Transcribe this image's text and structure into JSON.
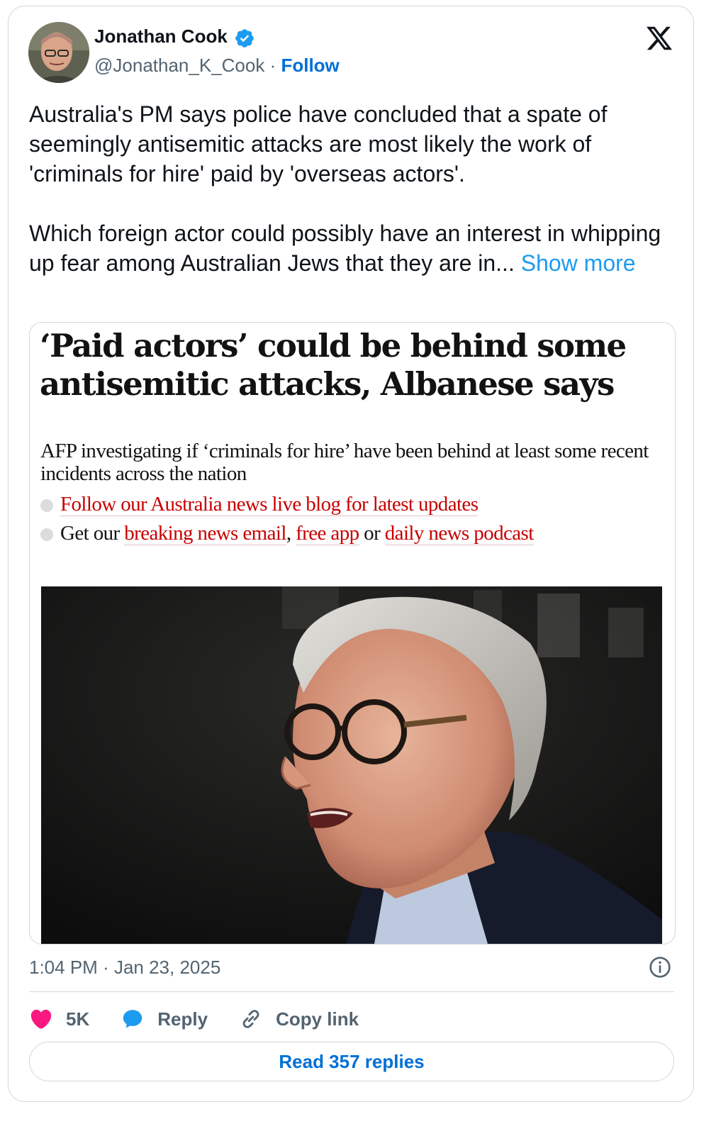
{
  "author": {
    "display_name": "Jonathan Cook",
    "handle": "@Jonathan_K_Cook",
    "separator": " · ",
    "follow_label": "Follow",
    "verified": true
  },
  "tweet": {
    "paragraph_1": "Australia's PM says police have concluded that a spate of seemingly antisemitic attacks are most likely the work of 'criminals for hire' paid by 'overseas actors'.",
    "paragraph_2": "Which foreign actor could possibly have an interest in whipping up fear among Australian Jews that they are in...",
    "show_more_label": "Show more"
  },
  "embedded_article": {
    "headline": "‘Paid actors’ could be behind some antisemitic attacks, Albanese says",
    "standfirst": "AFP investigating if ‘criminals for hire’ have been behind at least some recent incidents across the nation",
    "bullet_1": {
      "link": "Follow our Australia news live blog for latest updates"
    },
    "bullet_2": {
      "prefix": "Get our ",
      "link_1": "breaking news email",
      "sep_1": ", ",
      "link_2": "free app",
      "sep_2": " or ",
      "link_3": "daily news podcast"
    }
  },
  "meta": {
    "time": "1:04 PM",
    "separator": " · ",
    "date": "Jan 23, 2025"
  },
  "actions": {
    "likes": "5K",
    "reply_label": "Reply",
    "copy_link_label": "Copy link"
  },
  "read_replies_label": "Read 357 replies",
  "colors": {
    "link_blue": "#006fd6",
    "show_more_blue": "#1d9bf0",
    "like_pink": "#f91880",
    "reply_blue": "#1d9bf0",
    "guardian_red": "#c70000",
    "muted_gray": "#536471",
    "border": "#cfd9de"
  },
  "icons": [
    "verified-badge-icon",
    "x-logo-icon",
    "heart-icon",
    "reply-bubble-icon",
    "link-icon",
    "info-icon"
  ]
}
